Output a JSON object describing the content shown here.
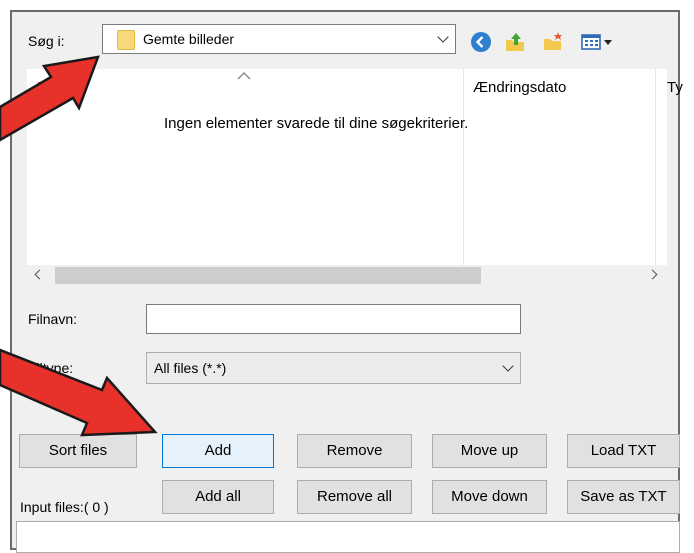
{
  "lookin": {
    "label": "Søg i:",
    "value": "Gemte billeder"
  },
  "toolbar": {
    "icons": [
      "back-icon",
      "up-folder-icon",
      "new-folder-icon",
      "view-menu-icon"
    ]
  },
  "filelist": {
    "columns": [
      "Navn",
      "Ændringsdato",
      "Ty"
    ],
    "empty_message": "Ingen elementer svarede til dine søgekriterier."
  },
  "filename": {
    "label": "Filnavn:",
    "value": ""
  },
  "filetype": {
    "label": "Filtype:",
    "value": "All files (*.*)"
  },
  "buttons": {
    "sort": "Sort files",
    "add": "Add",
    "remove": "Remove",
    "move_up": "Move up",
    "load_txt": "Load TXT",
    "add_all": "Add all",
    "remove_all": "Remove all",
    "move_down": "Move down",
    "save_txt": "Save as TXT"
  },
  "input_files_label": "Input files:( 0 )",
  "colors": {
    "annotation_arrow": "#e8312b",
    "focus_border": "#0078d7",
    "header_red": "#e00000"
  }
}
